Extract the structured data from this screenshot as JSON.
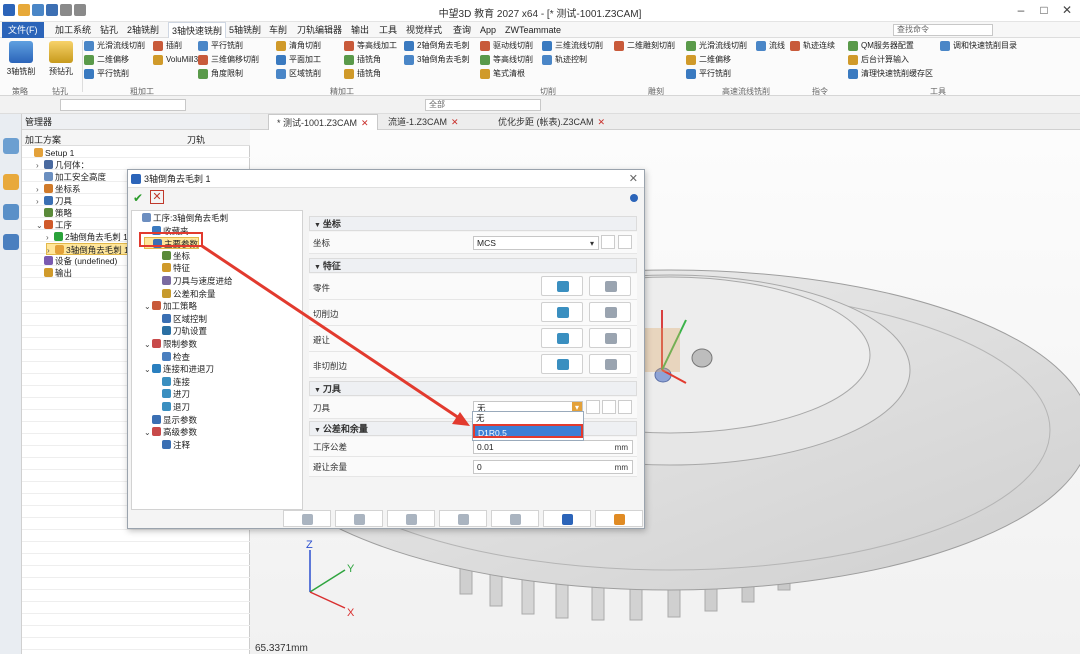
{
  "window": {
    "title": "中望3D 教育 2027 x64 - [* 测试-1001.Z3CAM]"
  },
  "menubar": {
    "items": [
      "文件(F)",
      "加工系统",
      "钻孔",
      "2轴铣削",
      "3轴快速铣削",
      "5轴铣削",
      "车削",
      "刀轨编辑器",
      "输出",
      "工具",
      "视觉样式",
      "查询",
      "App",
      "ZWTeammate"
    ],
    "active_index": 4,
    "search_placeholder": "查找命令"
  },
  "ribbon": {
    "big_buttons": [
      {
        "label": "3轴铣削"
      },
      {
        "label": "预钻孔"
      }
    ],
    "buttons": [
      "光滑流线切削",
      "插削",
      "二维偏移",
      "VoluMill3x",
      "平行铣削",
      "平行铣削",
      "三维偏移切削",
      "角度限制",
      "清角切削",
      "平面加工",
      "区域铣削",
      "等高线加工",
      "插铣角",
      "插铣角",
      "2轴倒角去毛刺",
      "3轴倒角去毛刺",
      "驱动线切削",
      "等高线切削",
      "笔式清根",
      "三维流线切削",
      "轨迹控制",
      "二维雕刻切削",
      "光滑流线切削",
      "二维偏移",
      "平行铣削",
      "流线",
      "轨迹连续",
      "QM服务器配置",
      "后台计算输入",
      "清理快速铣削缓存区",
      "调和快速铣削目录"
    ],
    "groups": [
      "策略",
      "钻孔",
      "粗加工",
      "精加工",
      "切削",
      "雕刻",
      "高速流线铣削",
      "指令",
      "工具"
    ]
  },
  "toolbar2": {
    "filter_placeholder": "全部"
  },
  "doc_tabs": [
    {
      "label": "* 测试-1001.Z3CAM",
      "active": true
    },
    {
      "label": "流道-1.Z3CAM",
      "active": false
    },
    {
      "label": "优化步距 (帐表).Z3CAM",
      "active": false
    }
  ],
  "manager": {
    "title": "管理器",
    "col1": "加工方案",
    "col2": "刀轨",
    "tree": [
      {
        "label": "Setup 1",
        "indent": 0,
        "arrow": ""
      },
      {
        "label": "几何体：",
        "indent": 1,
        "arrow": ">"
      },
      {
        "label": "加工安全高度",
        "indent": 1,
        "arrow": ""
      },
      {
        "label": "坐标系",
        "indent": 1,
        "arrow": ">"
      },
      {
        "label": "刀具",
        "indent": 1,
        "arrow": ">"
      },
      {
        "label": "策略",
        "indent": 1,
        "arrow": ""
      },
      {
        "label": "工序",
        "indent": 1,
        "arrow": "v"
      },
      {
        "label": "2轴倒角去毛刺 1",
        "indent": 2,
        "arrow": ">"
      },
      {
        "label": "3轴倒角去毛刺 1",
        "indent": 2,
        "arrow": ">",
        "highlight": true
      },
      {
        "label": "设备 (undefined)",
        "indent": 1,
        "arrow": ""
      },
      {
        "label": "输出",
        "indent": 1,
        "arrow": ""
      }
    ]
  },
  "dialog": {
    "title": "3轴倒角去毛刺 1",
    "tree": [
      {
        "label": "工序:3轴倒角去毛刺",
        "indent": 0,
        "arrow": ""
      },
      {
        "label": "收藏夹",
        "indent": 1,
        "arrow": ""
      },
      {
        "label": "主要参数",
        "indent": 1,
        "arrow": "v",
        "highlight": true
      },
      {
        "label": "坐标",
        "indent": 2,
        "arrow": ""
      },
      {
        "label": "特征",
        "indent": 2,
        "arrow": ""
      },
      {
        "label": "刀具与速度进给",
        "indent": 2,
        "arrow": ""
      },
      {
        "label": "公差和余量",
        "indent": 2,
        "arrow": ""
      },
      {
        "label": "加工策略",
        "indent": 1,
        "arrow": "v"
      },
      {
        "label": "区域控制",
        "indent": 2,
        "arrow": ""
      },
      {
        "label": "刀轨设置",
        "indent": 2,
        "arrow": ""
      },
      {
        "label": "限制参数",
        "indent": 1,
        "arrow": "v"
      },
      {
        "label": "检查",
        "indent": 2,
        "arrow": ""
      },
      {
        "label": "连接和进退刀",
        "indent": 1,
        "arrow": "v"
      },
      {
        "label": "连接",
        "indent": 2,
        "arrow": ""
      },
      {
        "label": "进刀",
        "indent": 2,
        "arrow": ""
      },
      {
        "label": "退刀",
        "indent": 2,
        "arrow": ""
      },
      {
        "label": "显示参数",
        "indent": 1,
        "arrow": ""
      },
      {
        "label": "高级参数",
        "indent": 1,
        "arrow": "v"
      },
      {
        "label": "注释",
        "indent": 2,
        "arrow": ""
      }
    ],
    "sections": {
      "coord": {
        "title": "坐标",
        "label": "坐标",
        "value": "MCS"
      },
      "feature": {
        "title": "特征",
        "rows": [
          "零件",
          "切削边",
          "避让",
          "非切削边"
        ]
      },
      "tool": {
        "title": "刀具",
        "label": "刀具",
        "value": "无",
        "options": [
          "无",
          "D1R0.5"
        ]
      },
      "tolerance": {
        "title": "公差和余量",
        "rows": [
          {
            "label": "工序公差",
            "value": "0.01",
            "unit": "mm"
          },
          {
            "label": "避让余量",
            "value": "0",
            "unit": "mm"
          }
        ]
      }
    }
  },
  "status": {
    "coord": "65.3371mm"
  },
  "colors": {
    "accent": "#2b64b9",
    "highlight_red": "#e23a2e",
    "tree_highlight": "#ffe69a"
  }
}
